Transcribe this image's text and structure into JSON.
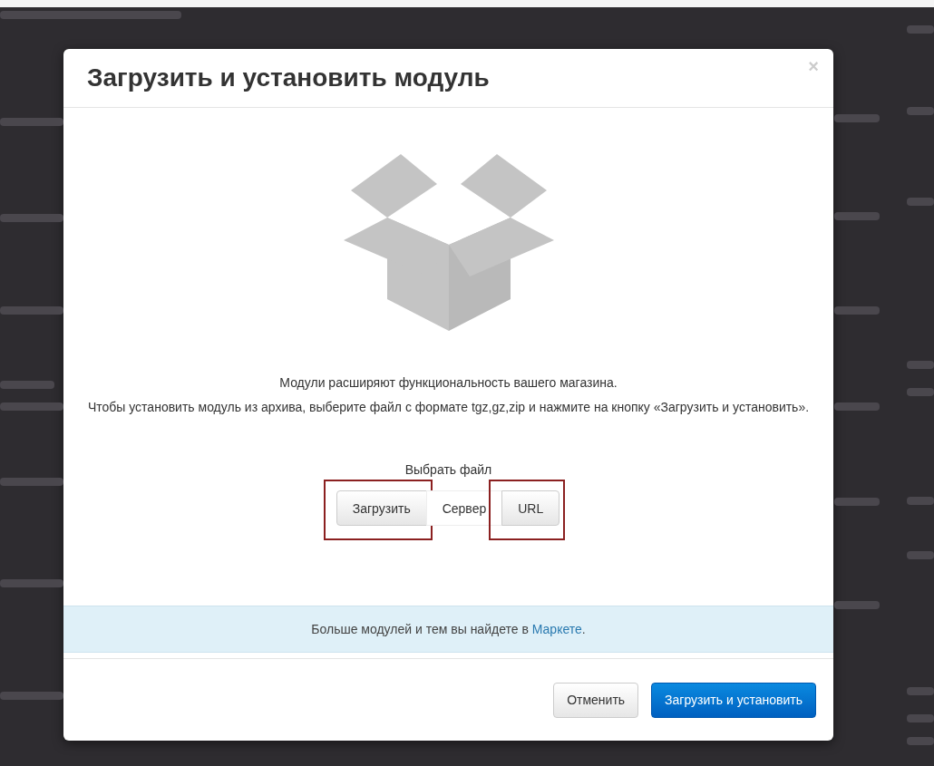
{
  "dialog": {
    "title": "Загрузить и установить модуль",
    "close": "×",
    "description": [
      "Модули расширяют функциональность вашего магазина.",
      "Чтобы установить модуль из архива, выберите файл с формате tgz,gz,zip и нажмите на кнопку «Загрузить и установить»."
    ],
    "source_label": "Выбрать файл",
    "sources": [
      {
        "label": "Загрузить",
        "selected": false,
        "highlighted": true
      },
      {
        "label": "Сервер",
        "selected": true,
        "highlighted": false
      },
      {
        "label": "URL",
        "selected": false,
        "highlighted": true
      }
    ],
    "notice": {
      "text": "Больше модулей и тем вы найдете в ",
      "link": "Маркете",
      "after": "."
    },
    "buttons": [
      {
        "label": "Отменить",
        "kind": "default"
      },
      {
        "label": "Загрузить и установить",
        "kind": "primary"
      }
    ]
  }
}
